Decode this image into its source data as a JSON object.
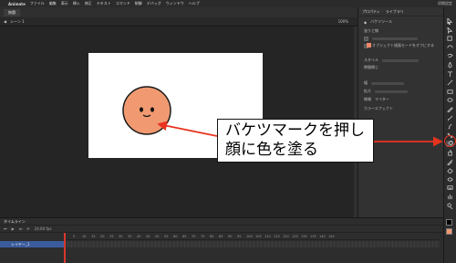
{
  "menubar": {
    "app_name": "Animate",
    "items": [
      "ファイル",
      "編集",
      "表示",
      "挿入",
      "修正",
      "テキスト",
      "コマンド",
      "制御",
      "デバッグ",
      "ウィンドウ",
      "ヘルプ"
    ],
    "right_text": "初期設定"
  },
  "document": {
    "tab_label": "無題",
    "scene_label": "シーン 1",
    "zoom": "100%"
  },
  "properties": {
    "tabs": [
      "プロパティ",
      "ライブラリ"
    ],
    "tool_title": "バケツツール",
    "section_fill_stroke": "塗りと線",
    "object_draw_label": "オブジェクト描画モードをオフにする",
    "style_label": "スタイル",
    "width_label": "幅",
    "scale_label": "拡大",
    "cap_label": "線端",
    "miter_label": "マイター",
    "color_effect_label": "カラーエフェクト",
    "fill_gap_label": "隙間閉じ"
  },
  "timeline": {
    "title": "タイムライン",
    "layer_name": "レイヤー_1",
    "fps": "24.00 fps",
    "frame_numbers": [
      "1",
      "5",
      "10",
      "15",
      "20",
      "25",
      "30",
      "35",
      "40",
      "45",
      "50",
      "55",
      "60",
      "65",
      "70",
      "75",
      "80",
      "85",
      "90",
      "95",
      "100",
      "105",
      "110",
      "115",
      "120",
      "125",
      "130",
      "135",
      "140",
      "145"
    ]
  },
  "callout": {
    "line1": "バケツマークを押し",
    "line2": "顔に色を塗る"
  },
  "colors": {
    "accent_red": "#e8331f",
    "face_fill": "#f19a72",
    "stage_bg": "#ffffff",
    "layer_highlight": "#3b5c9c"
  },
  "tools": [
    "selection-icon",
    "subselection-icon",
    "free-transform-icon",
    "3d-rotation-icon",
    "lasso-icon",
    "pen-icon",
    "text-icon",
    "line-icon",
    "rectangle-icon",
    "oval-icon",
    "pencil-icon",
    "brush-icon",
    "paint-brush-icon",
    "bone-icon",
    "paint-bucket-icon",
    "ink-bottle-icon",
    "eyedropper-icon",
    "eraser-icon",
    "width-icon",
    "camera-icon",
    "hand-icon",
    "zoom-icon"
  ]
}
